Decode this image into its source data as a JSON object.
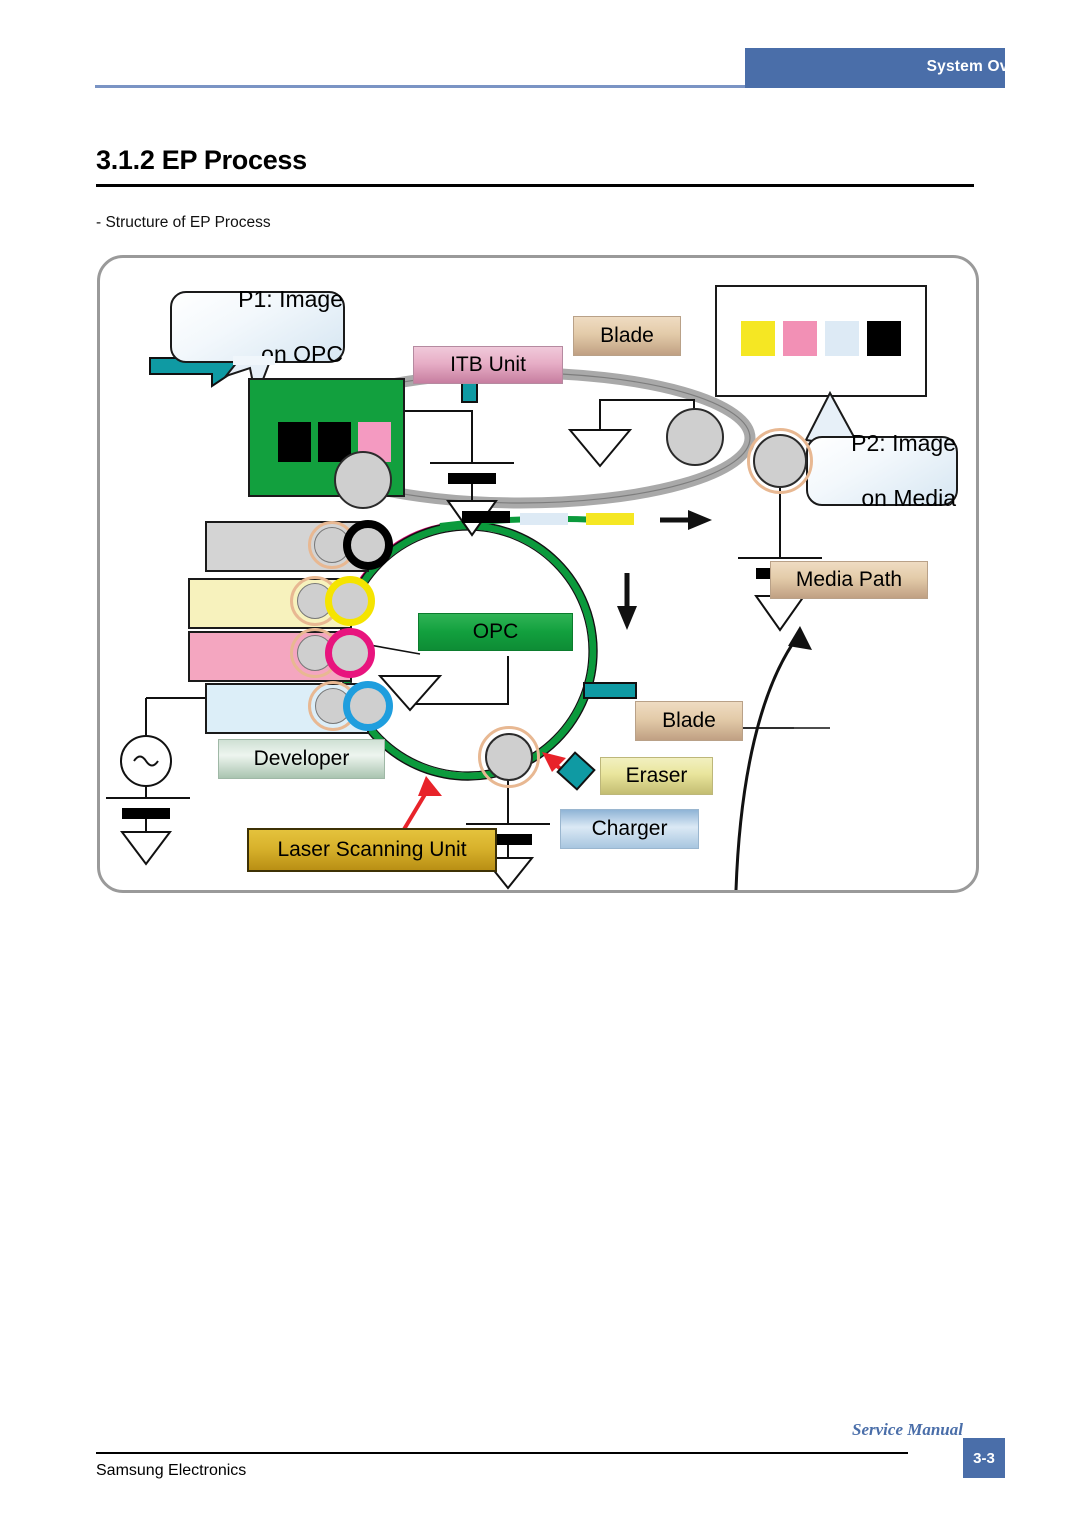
{
  "header": {
    "tab_label": "System Overview",
    "accent_color": "#4a6ea9"
  },
  "title": "3.1.2 EP Process",
  "subtitle": "- Structure of EP Process",
  "diagram": {
    "callouts": [
      {
        "id": "p1",
        "line1": "P1: Image",
        "line2": "on OPC"
      },
      {
        "id": "p2",
        "line1": "P2: Image",
        "line2": "on Media"
      }
    ],
    "labels": {
      "itb_unit": "ITB Unit",
      "blade_top": "Blade",
      "blade_bottom": "Blade",
      "media_path": "Media Path",
      "opc": "OPC",
      "developer": "Developer",
      "laser_scanning_unit": "Laser Scanning Unit",
      "eraser": "Eraser",
      "charger": "Charger"
    },
    "opc_image_block": {
      "background": "#12a03e",
      "swatches": [
        "#000000",
        "#000000",
        "#f49ac1"
      ]
    },
    "media_image_block": {
      "background": "#ffffff",
      "swatches": [
        "#f5e723",
        "#f290b5",
        "#ddeaf5",
        "#000000"
      ]
    },
    "developer_cartridges": [
      {
        "name": "black",
        "body_color": "#d4d4d4",
        "roller_color": "#000000"
      },
      {
        "name": "yellow",
        "body_color": "#f7f2bd",
        "roller_color": "#f5e400"
      },
      {
        "name": "magenta",
        "body_color": "#f4a6c0",
        "roller_color": "#e8147e"
      },
      {
        "name": "cyan",
        "body_color": "#dceef8",
        "roller_color": "#1f9ede"
      }
    ],
    "belt_toner_bars": [
      "#000000",
      "#ddeaf5",
      "#f5e723"
    ],
    "colors": {
      "opc_drum": "#0b9a3c",
      "opc_drum_secondary": "#d6006e",
      "itb_belt": "#a9a9a9",
      "teal_accent": "#0f9aa3",
      "charge_arrow": "#e8232a"
    }
  },
  "footer": {
    "left": "Samsung Electronics",
    "service_manual": "Service Manual",
    "page": "3-3"
  }
}
